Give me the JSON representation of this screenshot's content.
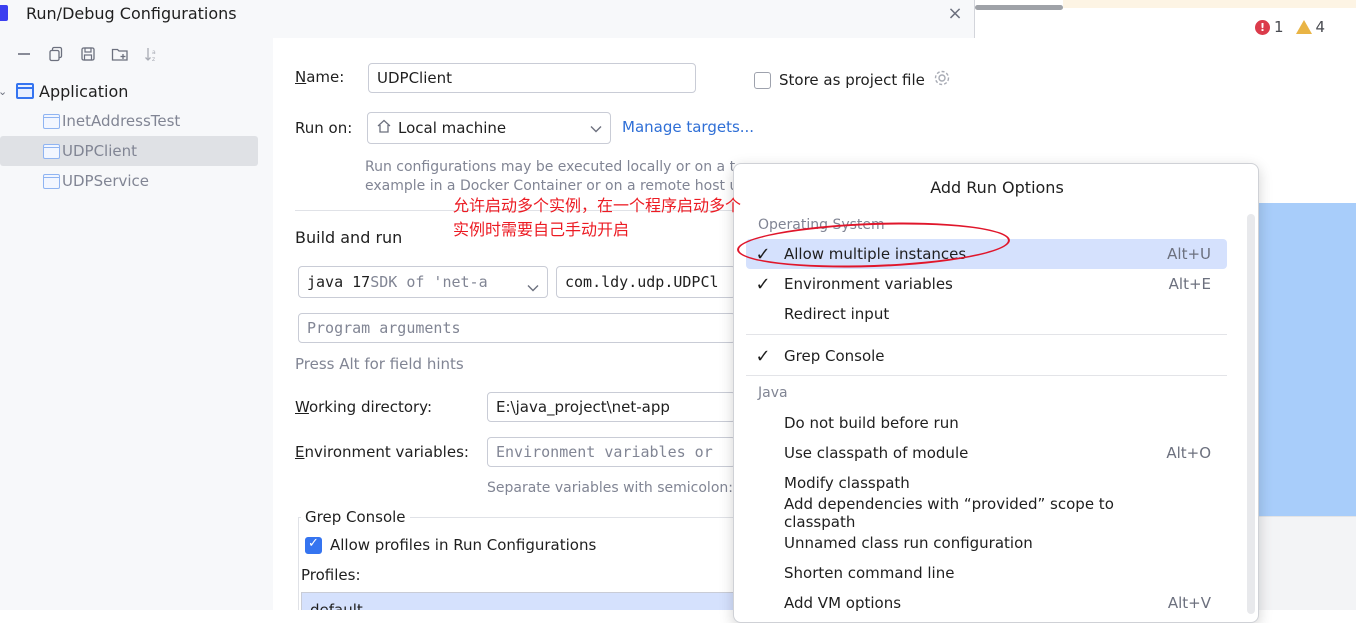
{
  "window": {
    "title": "Run/Debug Configurations",
    "close": "×"
  },
  "ide": {
    "error_count": "1",
    "warning_count": "4",
    "error_glyph": "!"
  },
  "tree": {
    "toolbar": [
      "minus-icon",
      "copy-icon",
      "save-icon",
      "new-folder-icon",
      "sort-icon"
    ],
    "group": "Application",
    "items": [
      "InetAddressTest",
      "UDPClient",
      "UDPService"
    ],
    "selected": "UDPClient"
  },
  "form": {
    "name_label_u": "N",
    "name_label_rest": "ame:",
    "name_value": "UDPClient",
    "store_label": "Store as project file",
    "run_on_label": "Run on:",
    "run_on_value": "Local machine",
    "manage_targets": "Manage targets...",
    "run_hint_1": "Run configurations may be executed locally or on a t",
    "run_hint_2": "example in a Docker Container or on a remote host u",
    "build_and_run": "Build and run",
    "jdk_main": "java 17",
    "jdk_sub": " SDK of 'net-a",
    "main_class": "com.ldy.udp.UDPCl",
    "program_args_placeholder": "Program arguments",
    "alt_hint": "Press Alt for field hints",
    "workdir_label_u": "W",
    "workdir_label_rest": "orking directory:",
    "workdir_value": "E:\\java_project\\net-app",
    "env_label_u": "E",
    "env_label_rest": "nvironment variables:",
    "env_placeholder": "Environment variables or",
    "env_hint": "Separate variables with semicolon:",
    "grep_console_title": "Grep Console",
    "allow_profiles": "Allow profiles in Run Configurations",
    "profiles_label": "Profiles:",
    "profiles_first": "default"
  },
  "annotation": {
    "line1": "允许启动多个实例，在一个程序启动多个",
    "line2": "实例时需要自己手动开启"
  },
  "popup": {
    "title": "Add Run Options",
    "groups": {
      "os": "Operating System",
      "java": "Java"
    },
    "items": [
      {
        "label": "Allow multiple instances",
        "shortcut": "Alt+U",
        "checked": true,
        "selected": true
      },
      {
        "label": "Environment variables",
        "shortcut": "Alt+E",
        "checked": true
      },
      {
        "label": "Redirect input",
        "shortcut": "",
        "checked": false
      },
      {
        "label": "Grep Console",
        "shortcut": "",
        "checked": true
      },
      {
        "label": "Do not build before run",
        "shortcut": "",
        "checked": false
      },
      {
        "label": "Use classpath of module",
        "shortcut": "Alt+O",
        "checked": false
      },
      {
        "label": "Modify classpath",
        "shortcut": "",
        "checked": false
      },
      {
        "label": "Add dependencies with “provided” scope to classpath",
        "shortcut": "",
        "checked": false
      },
      {
        "label": "Unnamed class run configuration",
        "shortcut": "",
        "checked": false
      },
      {
        "label": "Shorten command line",
        "shortcut": "",
        "checked": false
      },
      {
        "label": "Add VM options",
        "shortcut": "Alt+V",
        "checked": false
      }
    ],
    "check_glyph": "✓"
  },
  "colors": {
    "accent": "#3574f0",
    "annotation": "#ec1b23",
    "selection": "#d5e1fd"
  }
}
